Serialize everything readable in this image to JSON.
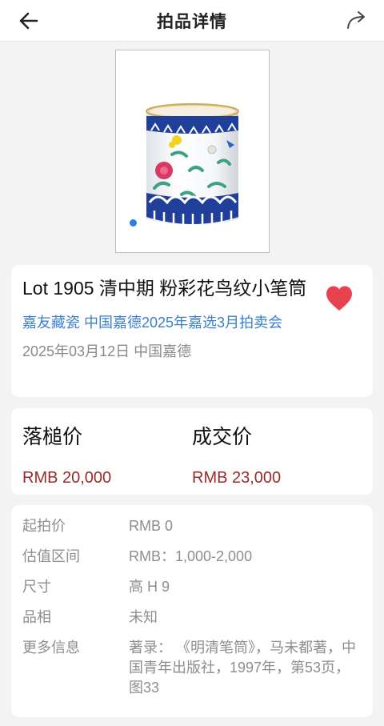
{
  "header": {
    "title": "拍品详情"
  },
  "gallery": {
    "active_index": 1,
    "total": 1
  },
  "lot": {
    "title": "Lot 1905 清中期  粉彩花鸟纹小笔筒",
    "auction_house": "嘉友藏瓷",
    "sale_name": "中国嘉德2025年嘉选3月拍卖会",
    "date_location": "2025年03月12日 中国嘉德",
    "favorited": true,
    "heart_color": "#e8414f"
  },
  "prices": {
    "hammer_label": "落槌价",
    "hammer_value": "RMB 20,000",
    "deal_label": "成交价",
    "deal_value": "RMB 23,000",
    "price_color": "#9b2a2a"
  },
  "details": [
    {
      "label": "起拍价",
      "value": "RMB 0"
    },
    {
      "label": "估值区间",
      "value": "RMB：1,000-2,000"
    },
    {
      "label": "尺寸",
      "value": "高  H 9"
    },
    {
      "label": "品相",
      "value": "未知"
    },
    {
      "label": "更多信息",
      "value": "著录：  《明清笔筒》，马未都著，中国青年出版社，1997年，第53页，图33"
    }
  ],
  "colors": {
    "link": "#3a7fd0",
    "dot": "#2f7ee8"
  }
}
